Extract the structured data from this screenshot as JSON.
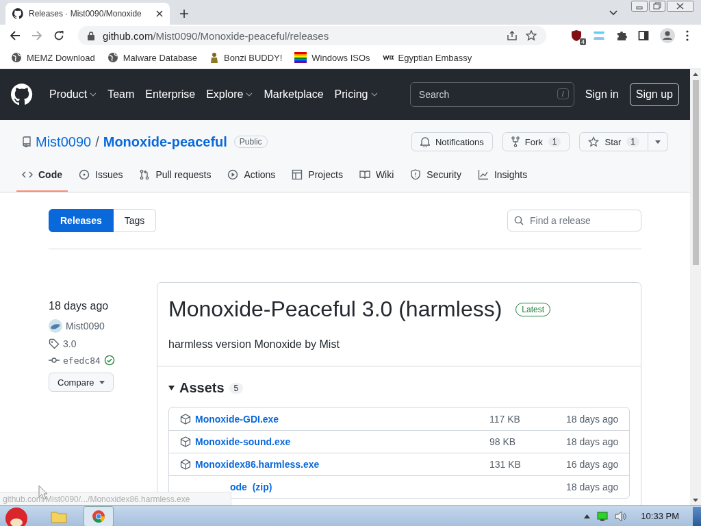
{
  "browser": {
    "tab_title": "Releases · Mist0090/Monoxide",
    "url_host": "github.com",
    "url_path": "/Mist0090/Monoxide-peaceful/releases",
    "extension_badge": "4",
    "bookmarks": [
      {
        "label": "MEMZ Download",
        "kind": "globe"
      },
      {
        "label": "Malware Database",
        "kind": "globe"
      },
      {
        "label": "Bonzi BUDDY!",
        "kind": "figure"
      },
      {
        "label": "Windows ISOs",
        "kind": "flag"
      },
      {
        "label": "Egyptian Embassy",
        "kind": "wix"
      }
    ]
  },
  "header": {
    "nav": [
      {
        "label": "Product",
        "dropdown": true
      },
      {
        "label": "Team",
        "dropdown": false
      },
      {
        "label": "Enterprise",
        "dropdown": false
      },
      {
        "label": "Explore",
        "dropdown": true
      },
      {
        "label": "Marketplace",
        "dropdown": false
      },
      {
        "label": "Pricing",
        "dropdown": true
      }
    ],
    "search_placeholder": "Search",
    "search_key": "/",
    "sign_in": "Sign in",
    "sign_up": "Sign up"
  },
  "repo": {
    "owner": "Mist0090",
    "separator": "/",
    "name": "Monoxide-peaceful",
    "visibility": "Public",
    "notifications": "Notifications",
    "fork": "Fork",
    "fork_count": "1",
    "star": "Star",
    "star_count": "1",
    "tabs": [
      {
        "label": "Code",
        "kind": "code",
        "selected": true
      },
      {
        "label": "Issues",
        "kind": "issues",
        "selected": false
      },
      {
        "label": "Pull requests",
        "kind": "pulls",
        "selected": false
      },
      {
        "label": "Actions",
        "kind": "actions",
        "selected": false
      },
      {
        "label": "Projects",
        "kind": "projects",
        "selected": false
      },
      {
        "label": "Wiki",
        "kind": "wiki",
        "selected": false
      },
      {
        "label": "Security",
        "kind": "security",
        "selected": false
      },
      {
        "label": "Insights",
        "kind": "insights",
        "selected": false
      }
    ]
  },
  "subnav": [
    {
      "label": "Releases",
      "selected": true
    },
    {
      "label": "Tags",
      "selected": false
    }
  ],
  "find_placeholder": "Find a release",
  "release": {
    "date": "18 days ago",
    "author": "Mist0090",
    "tag": "3.0",
    "commit": "efedc84",
    "verified": true,
    "compare": "Compare",
    "title": "Monoxide-Peaceful 3.0 (harmless)",
    "badge": "Latest",
    "description": "harmless version Monoxide by Mist",
    "assets_title": "Assets",
    "assets_count": "5",
    "expanded": true,
    "assets": [
      {
        "name": "Monoxide-GDI.exe",
        "size": "117 KB",
        "date": "18 days ago",
        "covered": false
      },
      {
        "name": "Monoxide-sound.exe",
        "size": "98 KB",
        "date": "18 days ago",
        "covered": false
      },
      {
        "name": "Monoxidex86.harmless.exe",
        "size": "131 KB",
        "date": "16 days ago",
        "covered": false
      },
      {
        "name": "ode  (zip)",
        "date": "18 days ago",
        "covered": true
      }
    ]
  },
  "status_url": "github.com/Mist0090/.../Monoxidex86.harmless.exe",
  "taskbar": {
    "clock": "10:33 PM"
  }
}
